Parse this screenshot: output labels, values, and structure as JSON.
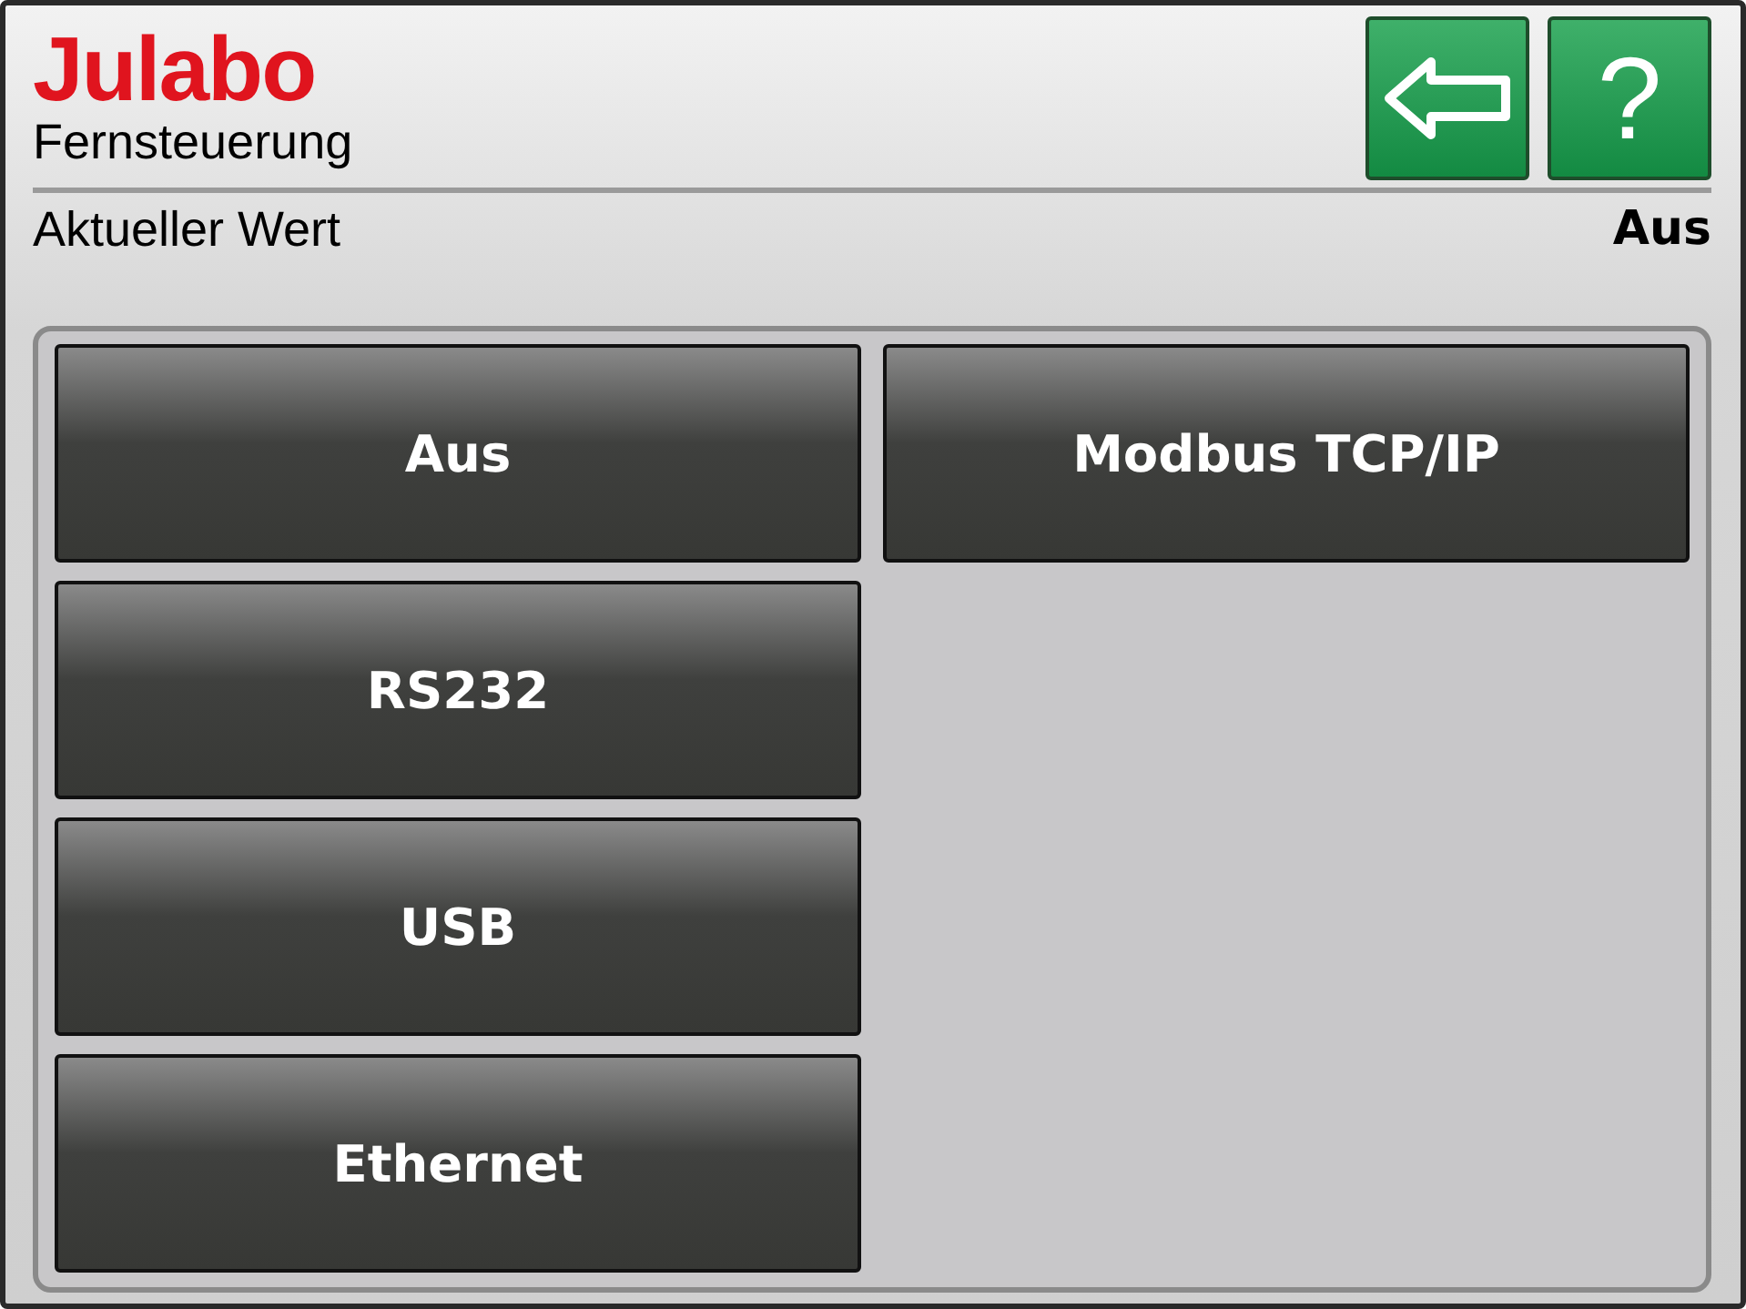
{
  "header": {
    "logo": "Julabo",
    "title": "Fernsteuerung",
    "buttons": [
      {
        "kind": "back"
      },
      {
        "kind": "help",
        "label": "?"
      }
    ]
  },
  "current": {
    "label": "Aktueller Wert",
    "value": "Aus"
  },
  "options": [
    {
      "label": "Aus"
    },
    {
      "label": "RS232"
    },
    {
      "label": "USB"
    },
    {
      "label": "Ethernet"
    },
    {
      "label": "Modbus TCP/IP"
    }
  ]
}
